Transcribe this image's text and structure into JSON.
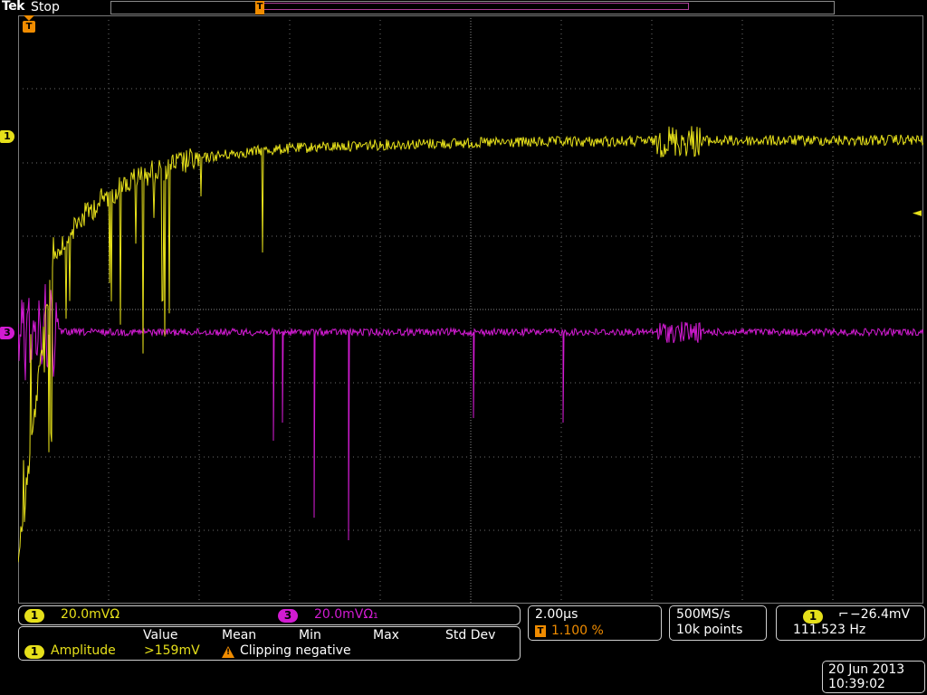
{
  "header": {
    "brand": "Tek",
    "run_state": "Stop"
  },
  "markers": {
    "trigger_position": "T",
    "trigger_top": "T",
    "ch1": "1",
    "ch3": "3",
    "trigger_level": "◄"
  },
  "colors": {
    "ch1": "#e6e01a",
    "ch3": "#d21bd2",
    "trigger": "#f08c00",
    "grid": "#6e6e6e"
  },
  "channels": [
    {
      "number": "1",
      "scale": "20.0mVΩ"
    },
    {
      "number": "3",
      "scale": "20.0mVΩ₁"
    }
  ],
  "timebase": {
    "scale": "2.00μs",
    "trigger_icon": "T",
    "position": "1.100 %"
  },
  "acquisition": {
    "sample_rate": "500MS/s",
    "record_length": "10k points"
  },
  "trigger": {
    "source": "1",
    "slope_icon": "falling-edge-icon",
    "slope_glyph": "⌐",
    "level": "−26.4mV",
    "frequency": "111.523 Hz"
  },
  "measurements": {
    "headers": [
      "Value",
      "Mean",
      "Min",
      "Max",
      "Std Dev"
    ],
    "rows": [
      {
        "source": "1",
        "name": "Amplitude",
        "value": ">159mV",
        "warning_icon": "warning-icon",
        "warning": "Clipping negative"
      }
    ]
  },
  "datetime": {
    "date": "20 Jun  2013",
    "time": "10:39:02"
  }
}
